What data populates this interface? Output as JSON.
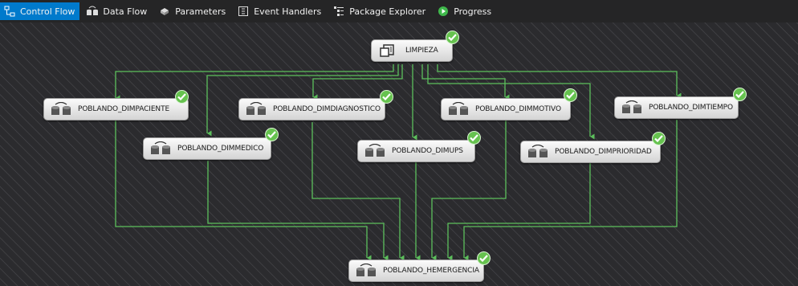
{
  "tabs": [
    {
      "label": "Control Flow",
      "icon": "control-flow-icon",
      "active": true
    },
    {
      "label": "Data Flow",
      "icon": "data-flow-icon",
      "active": false
    },
    {
      "label": "Parameters",
      "icon": "parameters-icon",
      "active": false
    },
    {
      "label": "Event Handlers",
      "icon": "event-handlers-icon",
      "active": false
    },
    {
      "label": "Package Explorer",
      "icon": "package-explorer-icon",
      "active": false
    },
    {
      "label": "Progress",
      "icon": "progress-play-icon",
      "active": false
    }
  ],
  "tasks": {
    "limpieza": {
      "label": "LIMPIEZA",
      "status": "success"
    },
    "dimpaciente": {
      "label": "POBLANDO_DIMPACIENTE",
      "status": "success"
    },
    "dimdiagnostico": {
      "label": "POBLANDO_DIMDIAGNOSTICO",
      "status": "success"
    },
    "dimmotivo": {
      "label": "POBLANDO_DIMMOTIVO",
      "status": "success"
    },
    "dimtiempo": {
      "label": "POBLANDO_DIMTIEMPO",
      "status": "success"
    },
    "dimmedico": {
      "label": "POBLANDO_DIMMEDICO",
      "status": "success"
    },
    "dimups": {
      "label": "POBLANDO_DIMUPS",
      "status": "success"
    },
    "dimprioridad": {
      "label": "POBLANDO_DIMPRIORIDAD",
      "status": "success"
    },
    "hemergencia": {
      "label": "POBLANDO_HEMERGENCIA",
      "status": "success"
    }
  },
  "colors": {
    "accent": "#007acc",
    "connector": "#5cbf5c",
    "success": "#66c24f",
    "canvas": "#2d2d30"
  }
}
